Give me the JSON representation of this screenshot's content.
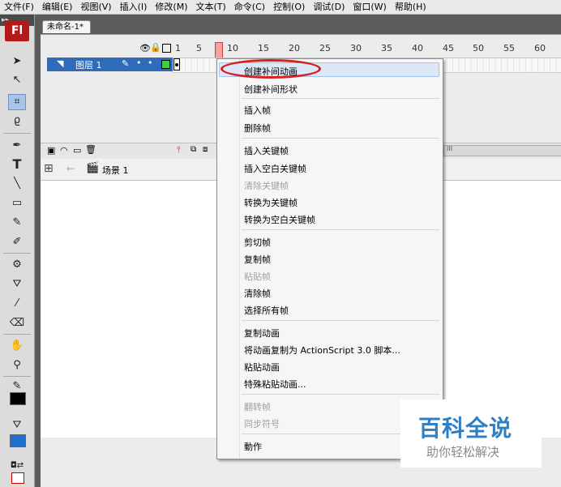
{
  "menubar": {
    "grip": "▸▸",
    "items": [
      "文件(F)",
      "编辑(E)",
      "视图(V)",
      "插入(I)",
      "修改(M)",
      "文本(T)",
      "命令(C)",
      "控制(O)",
      "调试(D)",
      "窗口(W)",
      "帮助(H)"
    ]
  },
  "app": {
    "logo": "Fl"
  },
  "document": {
    "tab_title": "未命名-1*"
  },
  "timeline": {
    "ruler": [
      "1",
      "5",
      "10",
      "15",
      "20",
      "25",
      "30",
      "35",
      "40",
      "45",
      "50",
      "55",
      "60"
    ],
    "layer_name": "图层 1",
    "scroll_marker": "III"
  },
  "scene": {
    "name": "场景 1"
  },
  "context_menu": {
    "items": [
      {
        "label": "创建补间动画",
        "disabled": false
      },
      {
        "label": "创建补间形状",
        "disabled": false
      },
      {
        "label": "插入帧",
        "disabled": false
      },
      {
        "label": "删除帧",
        "disabled": false
      },
      {
        "label": "插入关键帧",
        "disabled": false
      },
      {
        "label": "插入空白关键帧",
        "disabled": false
      },
      {
        "label": "清除关键帧",
        "disabled": true
      },
      {
        "label": "转换为关键帧",
        "disabled": false
      },
      {
        "label": "转换为空白关键帧",
        "disabled": false
      },
      {
        "label": "剪切帧",
        "disabled": false
      },
      {
        "label": "复制帧",
        "disabled": false
      },
      {
        "label": "粘贴帧",
        "disabled": true
      },
      {
        "label": "清除帧",
        "disabled": false
      },
      {
        "label": "选择所有帧",
        "disabled": false
      },
      {
        "label": "复制动画",
        "disabled": false
      },
      {
        "label": "将动画复制为 ActionScript 3.0 脚本...",
        "disabled": false
      },
      {
        "label": "粘贴动画",
        "disabled": false
      },
      {
        "label": "特殊粘贴动画...",
        "disabled": false
      },
      {
        "label": "翻转帧",
        "disabled": true
      },
      {
        "label": "同步符号",
        "disabled": true
      },
      {
        "label": "動作",
        "disabled": false
      }
    ]
  },
  "watermark": {
    "title": "百科全说",
    "subtitle": "助你轻松解决"
  },
  "colors": {
    "accent": "#2f6bb8",
    "highlight": "#d42020",
    "watermark": "#2f7fc2"
  }
}
